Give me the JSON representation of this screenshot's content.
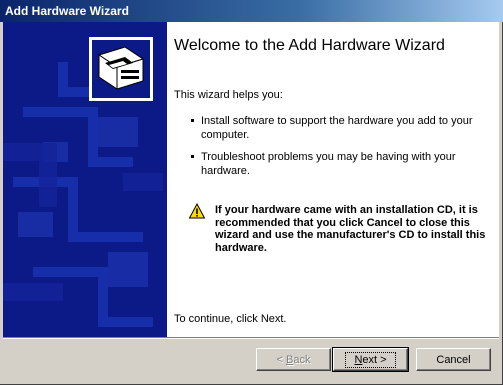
{
  "window": {
    "title": "Add Hardware Wizard"
  },
  "content": {
    "heading": "Welcome to the Add Hardware Wizard",
    "intro": "This wizard helps you:",
    "bullets": [
      "Install software to support the hardware you add to your computer.",
      "Troubleshoot problems you may be having with your hardware."
    ],
    "warning": "If your hardware came with an installation CD, it is recommended that you click Cancel to close this wizard and use the manufacturer's CD to install this hardware.",
    "footer": "To continue, click Next."
  },
  "buttons": {
    "back_prefix": "< ",
    "back_accel": "B",
    "back_rest": "ack",
    "next_accel": "N",
    "next_rest": "ext >",
    "cancel": "Cancel"
  },
  "icons": {
    "wizard": "hardware-board-icon",
    "warning": "warning-icon"
  },
  "colors": {
    "sidebar": "#0b1a86",
    "titlebar": "#0a246a",
    "warning": "#ffd800"
  }
}
